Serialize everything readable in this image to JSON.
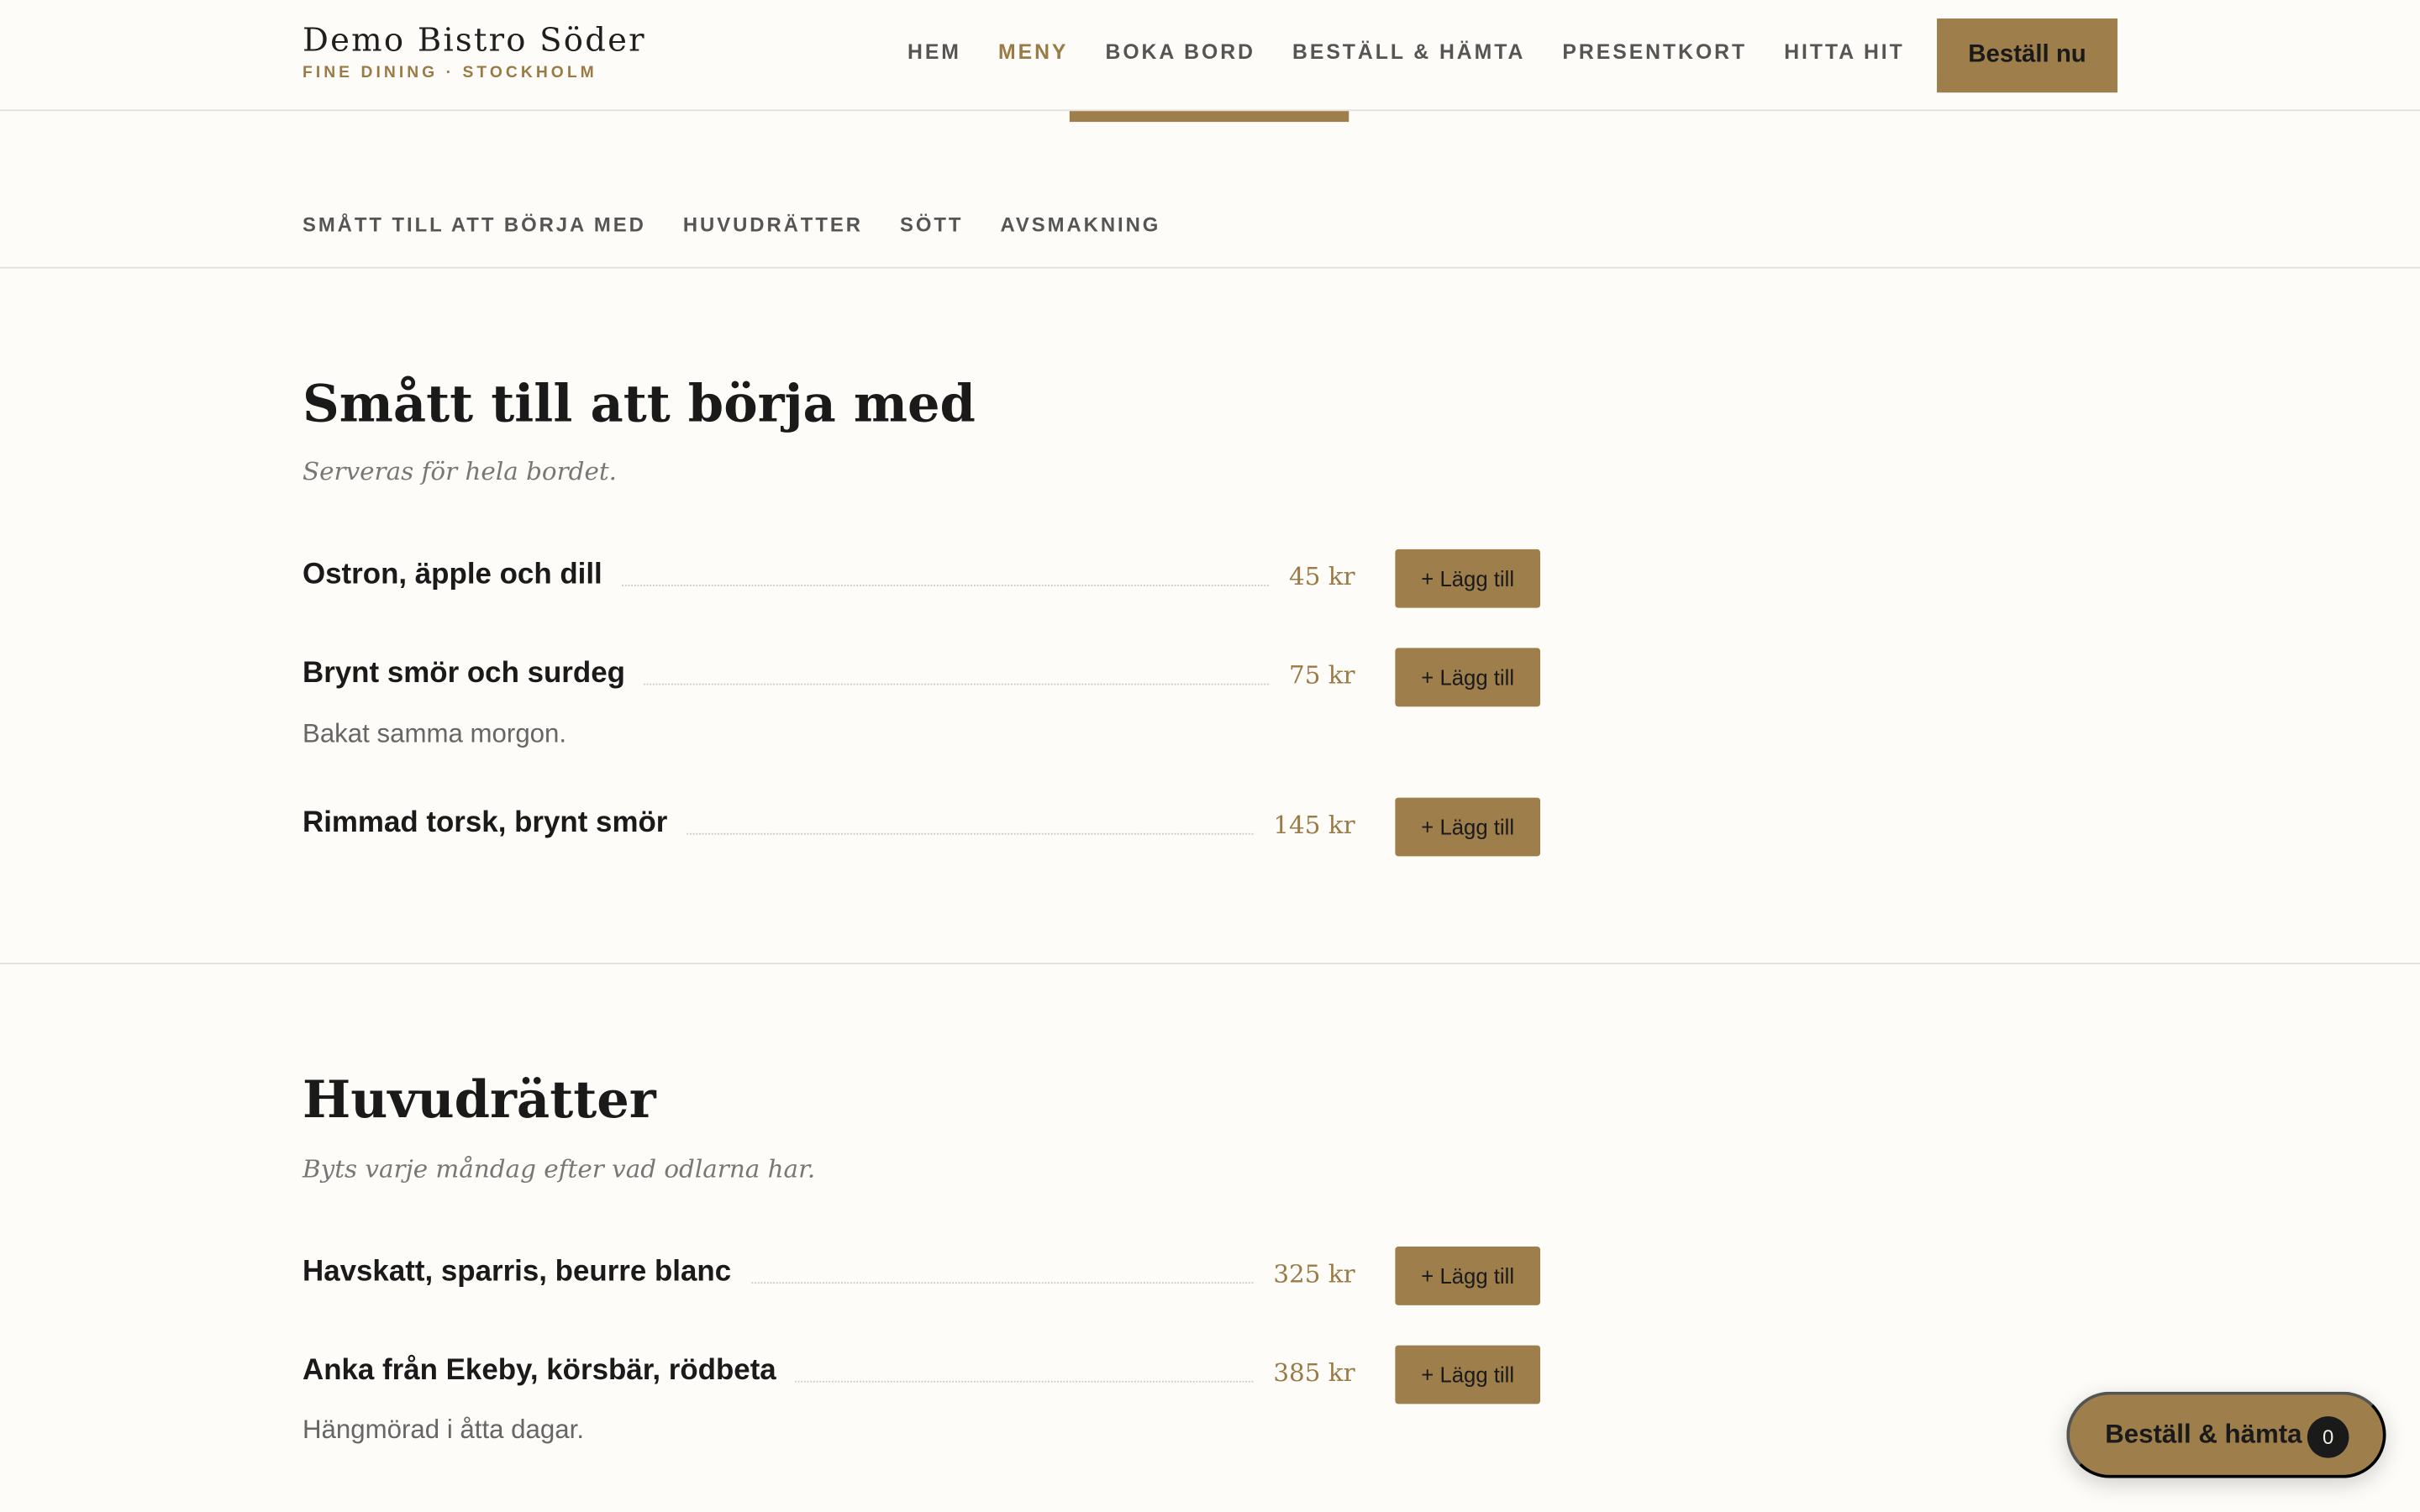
{
  "brand": {
    "name": "Demo Bistro Söder",
    "tagline": "FINE DINING · STOCKHOLM"
  },
  "nav": {
    "items": [
      {
        "label": "HEM"
      },
      {
        "label": "MENY"
      },
      {
        "label": "BOKA BORD"
      },
      {
        "label": "BESTÄLL & HÄMTA"
      },
      {
        "label": "PRESENTKORT"
      },
      {
        "label": "HITTA HIT"
      }
    ],
    "active": "MENY",
    "cta": "Beställ nu"
  },
  "categories": [
    "SMÅTT TILL ATT BÖRJA MED",
    "HUVUDRÄTTER",
    "SÖTT",
    "AVSMAKNING"
  ],
  "sections": [
    {
      "title": "Smått till att börja med",
      "subtitle": "Serveras för hela bordet.",
      "items": [
        {
          "name": "Ostron, äpple och dill",
          "price": "45 kr",
          "desc": ""
        },
        {
          "name": "Brynt smör och surdeg",
          "price": "75 kr",
          "desc": "Bakat samma morgon."
        },
        {
          "name": "Rimmad torsk, brynt smör",
          "price": "145 kr",
          "desc": ""
        }
      ]
    },
    {
      "title": "Huvudrätter",
      "subtitle": "Byts varje måndag efter vad odlarna har.",
      "items": [
        {
          "name": "Havskatt, sparris, beurre blanc",
          "price": "325 kr",
          "desc": ""
        },
        {
          "name": "Anka från Ekeby, körsbär, rödbeta",
          "price": "385 kr",
          "desc": "Hängmörad i åtta dagar."
        }
      ]
    }
  ],
  "add_label": "+ Lägg till",
  "cart": {
    "label": "Beställ & hämta",
    "count": "0"
  },
  "colors": {
    "accent": "#9e7e4a",
    "background": "#fdfcf9",
    "text": "#1a1a1a"
  }
}
